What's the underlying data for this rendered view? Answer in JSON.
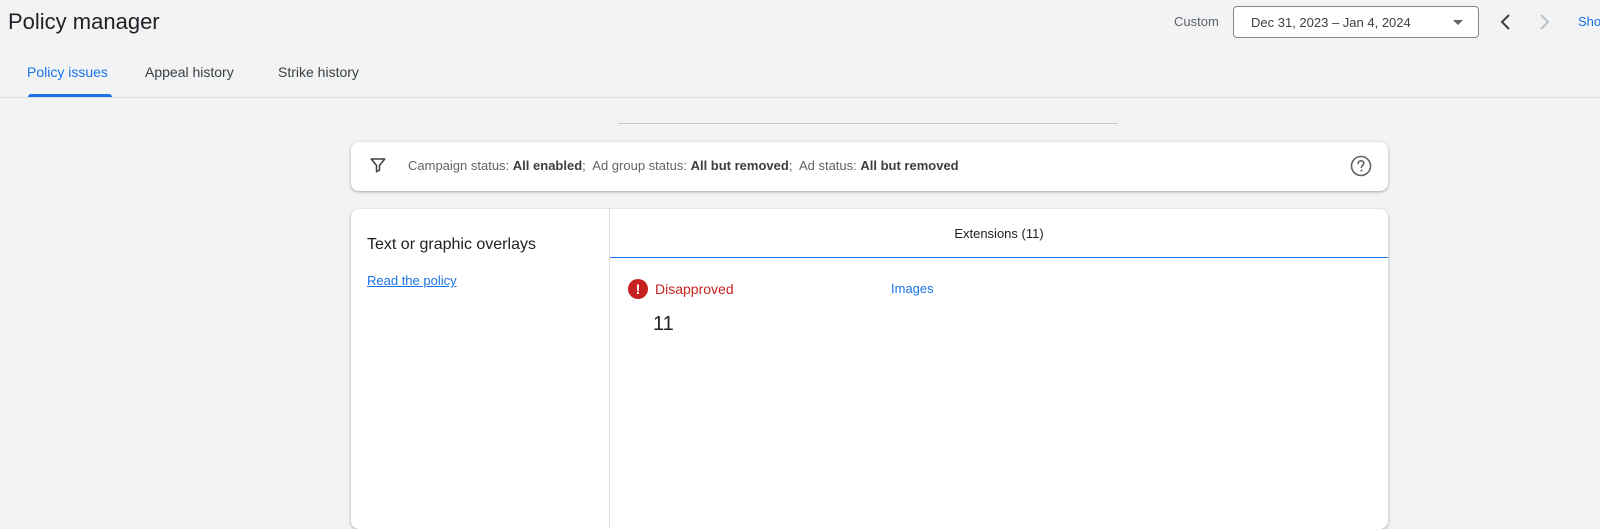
{
  "header": {
    "title": "Policy manager",
    "date_range_label": "Custom",
    "date_range_value": "Dec 31, 2023 – Jan 4, 2024",
    "show_link": "Sho"
  },
  "tabs": [
    {
      "label": "Policy issues",
      "active": true
    },
    {
      "label": "Appeal history",
      "active": false
    },
    {
      "label": "Strike history",
      "active": false
    }
  ],
  "filter": {
    "segments": [
      {
        "key": "Campaign status:",
        "value": "All enabled"
      },
      {
        "key": "Ad group status:",
        "value": "All but removed"
      },
      {
        "key": "Ad status:",
        "value": "All but removed"
      }
    ]
  },
  "policy": {
    "title": "Text or graphic overlays",
    "link_label": "Read the policy"
  },
  "extensions": {
    "header": "Extensions (11)",
    "status_label": "Disapproved",
    "status_count": "11",
    "asset_type": "Images"
  },
  "colors": {
    "accent": "#1a73e8",
    "error": "#c5221f",
    "background": "#f1f3f4"
  },
  "icons": {
    "date_dropdown": "chevron-down-icon",
    "prev": "chevron-left-icon",
    "next": "chevron-right-icon",
    "filter": "filter-icon",
    "help": "help-icon",
    "status": "error-icon"
  }
}
